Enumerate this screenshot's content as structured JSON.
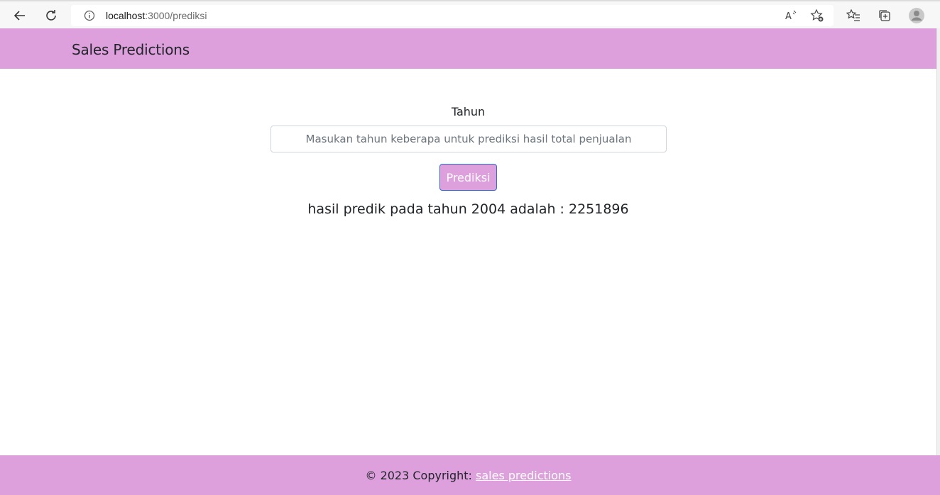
{
  "browser": {
    "url_host": "localhost",
    "url_path": ":3000/prediksi"
  },
  "header": {
    "brand": "Sales Predictions"
  },
  "form": {
    "year_label": "Tahun",
    "year_placeholder": "Masukan tahun keberapa untuk prediksi hasil total penjualan",
    "year_value": "",
    "submit_label": "Prediksi"
  },
  "result": {
    "text": "hasil predik pada tahun 2004 adalah : 2251896"
  },
  "footer": {
    "copyright": "© 2023 Copyright: ",
    "link_label": "sales predictions"
  },
  "colors": {
    "accent": "#dda0dd",
    "button_border": "#2f6fdd"
  }
}
